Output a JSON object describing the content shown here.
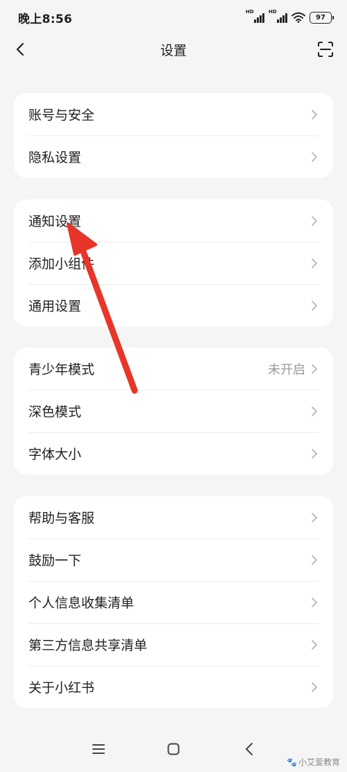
{
  "status_bar": {
    "time": "晚上8:56",
    "signal_label_1": "HD",
    "signal_label_2": "HD",
    "battery": "97"
  },
  "header": {
    "title": "设置",
    "back_icon": "chevron-left-icon",
    "scan_icon": "scan-icon"
  },
  "sections": [
    {
      "items": [
        {
          "label": "账号与安全",
          "value": ""
        },
        {
          "label": "隐私设置",
          "value": ""
        }
      ]
    },
    {
      "items": [
        {
          "label": "通知设置",
          "value": ""
        },
        {
          "label": "添加小组件",
          "value": ""
        },
        {
          "label": "通用设置",
          "value": ""
        }
      ]
    },
    {
      "items": [
        {
          "label": "青少年模式",
          "value": "未开启"
        },
        {
          "label": "深色模式",
          "value": ""
        },
        {
          "label": "字体大小",
          "value": ""
        }
      ]
    },
    {
      "items": [
        {
          "label": "帮助与客服",
          "value": ""
        },
        {
          "label": "鼓励一下",
          "value": ""
        },
        {
          "label": "个人信息收集清单",
          "value": ""
        },
        {
          "label": "第三方信息共享清单",
          "value": ""
        },
        {
          "label": "关于小红书",
          "value": ""
        }
      ]
    }
  ],
  "watermark": "小艾爱教育",
  "colors": {
    "background": "#f5f5f6",
    "card": "#ffffff",
    "annotation_arrow": "#e8352a",
    "secondary_text": "#9a9a9a"
  }
}
